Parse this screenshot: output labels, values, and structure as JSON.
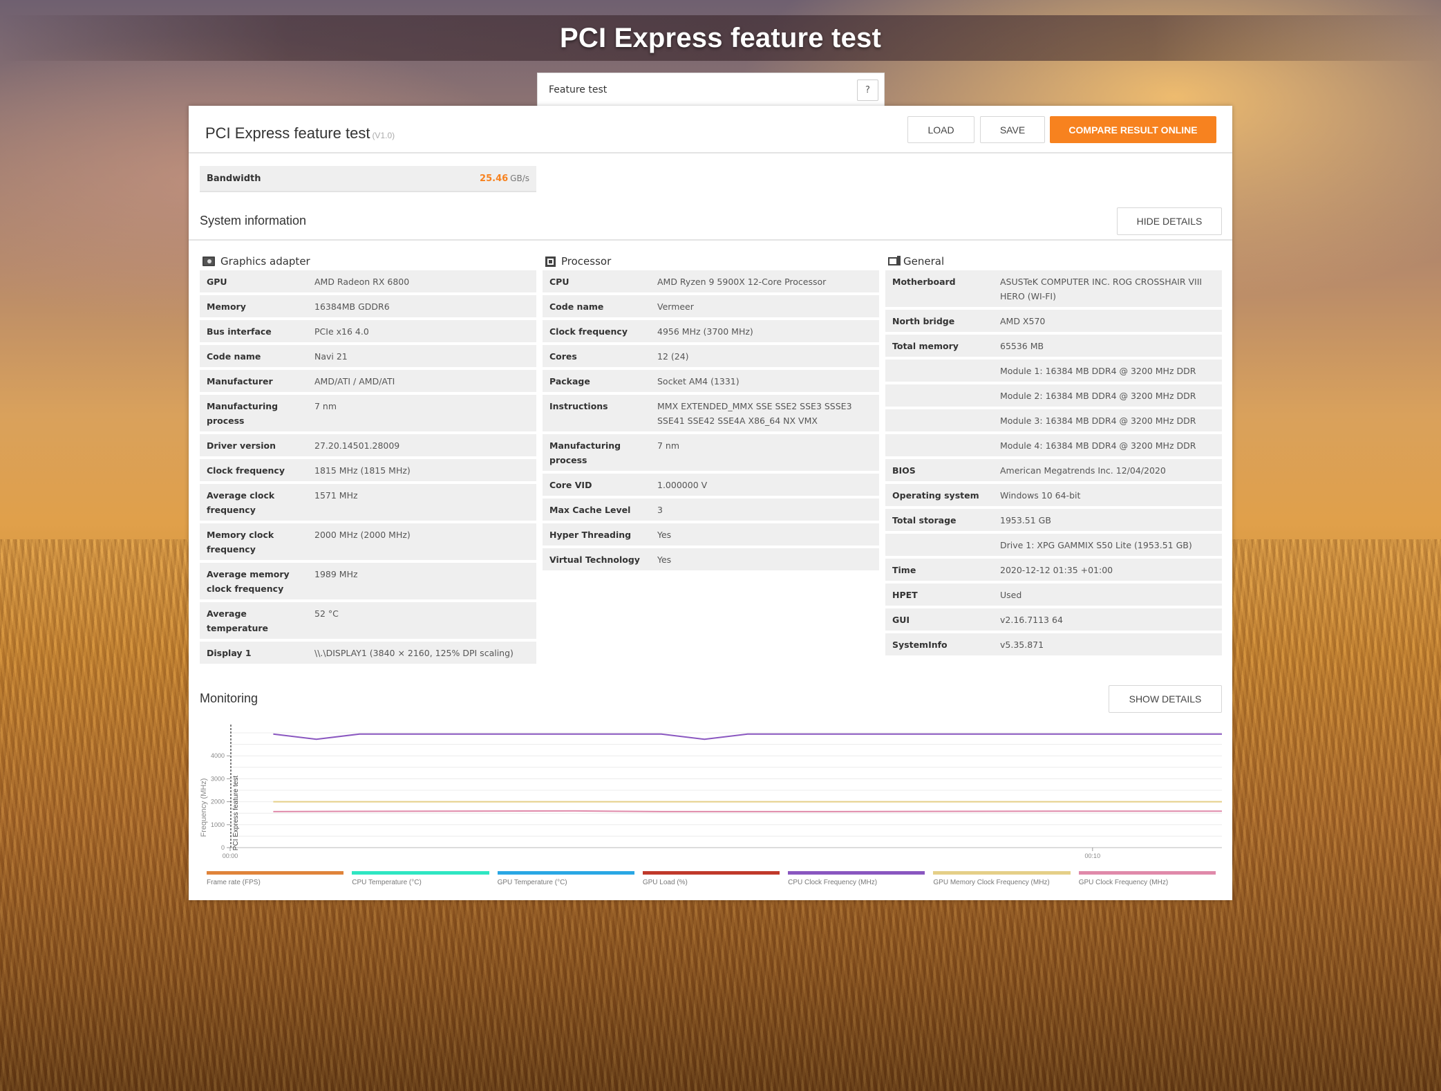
{
  "page_title": "PCI Express feature test",
  "feature_select": {
    "value": "Feature test",
    "help_label": "?"
  },
  "panel": {
    "title": "PCI Express feature test",
    "version": "(V1.0)",
    "buttons": {
      "load": "LOAD",
      "save": "SAVE",
      "compare": "COMPARE RESULT ONLINE"
    },
    "accent_color": "#f7821f"
  },
  "score": {
    "label": "Bandwidth",
    "value": "25.46",
    "unit": "GB/s"
  },
  "system_info": {
    "title": "System information",
    "toggle_label": "HIDE DETAILS",
    "columns": [
      {
        "title": "Graphics adapter",
        "icon": "graphics-card-icon",
        "rows": [
          {
            "k": "GPU",
            "v": "AMD Radeon RX 6800"
          },
          {
            "k": "Memory",
            "v": "16384MB GDDR6"
          },
          {
            "k": "Bus interface",
            "v": "PCIe x16 4.0"
          },
          {
            "k": "Code name",
            "v": "Navi 21"
          },
          {
            "k": "Manufacturer",
            "v": "AMD/ATI / AMD/ATI"
          },
          {
            "k": "Manufacturing process",
            "v": "7 nm"
          },
          {
            "k": "Driver version",
            "v": "27.20.14501.28009"
          },
          {
            "k": "Clock frequency",
            "v": "1815 MHz (1815 MHz)"
          },
          {
            "k": "Average clock frequency",
            "v": "1571 MHz"
          },
          {
            "k": "Memory clock frequency",
            "v": "2000 MHz (2000 MHz)"
          },
          {
            "k": "Average memory clock frequency",
            "v": "1989 MHz"
          },
          {
            "k": "Average temperature",
            "v": "52 °C"
          },
          {
            "k": "Display 1",
            "v": "\\\\.\\DISPLAY1 (3840 × 2160, 125% DPI scaling)"
          }
        ]
      },
      {
        "title": "Processor",
        "icon": "processor-icon",
        "rows": [
          {
            "k": "CPU",
            "v": "AMD Ryzen 9 5900X 12-Core Processor"
          },
          {
            "k": "Code name",
            "v": "Vermeer"
          },
          {
            "k": "Clock frequency",
            "v": "4956 MHz (3700 MHz)"
          },
          {
            "k": "Cores",
            "v": "12 (24)"
          },
          {
            "k": "Package",
            "v": "Socket AM4 (1331)"
          },
          {
            "k": "Instructions",
            "v": "MMX EXTENDED_MMX SSE SSE2 SSE3 SSSE3 SSE41 SSE42 SSE4A X86_64 NX VMX"
          },
          {
            "k": "Manufacturing process",
            "v": "7 nm"
          },
          {
            "k": "Core VID",
            "v": "1.000000 V"
          },
          {
            "k": "Max Cache Level",
            "v": "3"
          },
          {
            "k": "Hyper Threading",
            "v": "Yes"
          },
          {
            "k": "Virtual Technology",
            "v": "Yes"
          }
        ]
      },
      {
        "title": "General",
        "icon": "computer-icon",
        "rows": [
          {
            "k": "Motherboard",
            "v": "ASUSTeK COMPUTER INC. ROG CROSSHAIR VIII HERO (WI-FI)"
          },
          {
            "k": "North bridge",
            "v": "AMD X570"
          },
          {
            "k": "Total memory",
            "v": "65536 MB"
          },
          {
            "k": "",
            "v": "Module 1: 16384 MB DDR4 @ 3200 MHz DDR"
          },
          {
            "k": "",
            "v": "Module 2: 16384 MB DDR4 @ 3200 MHz DDR"
          },
          {
            "k": "",
            "v": "Module 3: 16384 MB DDR4 @ 3200 MHz DDR"
          },
          {
            "k": "",
            "v": "Module 4: 16384 MB DDR4 @ 3200 MHz DDR"
          },
          {
            "k": "BIOS",
            "v": "American Megatrends Inc. 12/04/2020"
          },
          {
            "k": "Operating system",
            "v": "Windows 10 64-bit"
          },
          {
            "k": "Total storage",
            "v": "1953.51 GB"
          },
          {
            "k": "",
            "v": "Drive 1: XPG GAMMIX S50 Lite (1953.51 GB)"
          },
          {
            "k": "Time",
            "v": "2020-12-12 01:35 +01:00"
          },
          {
            "k": "HPET",
            "v": "Used"
          },
          {
            "k": "GUI",
            "v": "v2.16.7113 64"
          },
          {
            "k": "SystemInfo",
            "v": "v5.35.871"
          }
        ]
      }
    ]
  },
  "monitoring": {
    "title": "Monitoring",
    "toggle_label": "SHOW DETAILS"
  },
  "chart_data": {
    "type": "line",
    "ylabel": "Frequency (MHz)",
    "xlabel": "",
    "ylim": [
      0,
      5000
    ],
    "yticks": [
      0,
      1000,
      2000,
      3000,
      4000
    ],
    "xlim": [
      0,
      11.5
    ],
    "xticks": [
      {
        "value": 0,
        "label": "00:00"
      },
      {
        "value": 10,
        "label": "00:10"
      }
    ],
    "grid": true,
    "marker": {
      "x": 0,
      "label": "PCI Express feature test"
    },
    "legend_position": "bottom",
    "legend": [
      {
        "name": "Frame rate (FPS)",
        "color": "#e0843a"
      },
      {
        "name": "CPU Temperature (°C)",
        "color": "#2fe6c2"
      },
      {
        "name": "GPU Temperature (°C)",
        "color": "#2aa7e4"
      },
      {
        "name": "GPU Load (%)",
        "color": "#c0392b"
      },
      {
        "name": "CPU Clock Frequency (MHz)",
        "color": "#8a57c0"
      },
      {
        "name": "GPU Memory Clock Frequency (MHz)",
        "color": "#e5cf88"
      },
      {
        "name": "GPU Clock Frequency (MHz)",
        "color": "#e08aaa"
      }
    ],
    "series": [
      {
        "name": "CPU Clock Frequency (MHz)",
        "color": "#8a57c0",
        "x": [
          0.5,
          1.0,
          1.5,
          2.0,
          3.0,
          4.0,
          5.0,
          5.5,
          6.0,
          6.5,
          7.0,
          8.0,
          9.0,
          10.0,
          11.0,
          11.5
        ],
        "y": [
          4950,
          4720,
          4950,
          4950,
          4950,
          4950,
          4950,
          4720,
          4950,
          4950,
          4950,
          4950,
          4950,
          4950,
          4950,
          4950
        ]
      },
      {
        "name": "GPU Memory Clock Frequency (MHz)",
        "color": "#e5cf88",
        "x": [
          0.5,
          11.5
        ],
        "y": [
          2000,
          2000
        ]
      },
      {
        "name": "GPU Clock Frequency (MHz)",
        "color": "#e08aaa",
        "x": [
          0.5,
          1.5,
          2.5,
          4.0,
          5.0,
          6.0,
          7.0,
          8.5,
          10.0,
          11.5
        ],
        "y": [
          1570,
          1580,
          1590,
          1600,
          1570,
          1570,
          1570,
          1580,
          1590,
          1590
        ]
      }
    ]
  }
}
